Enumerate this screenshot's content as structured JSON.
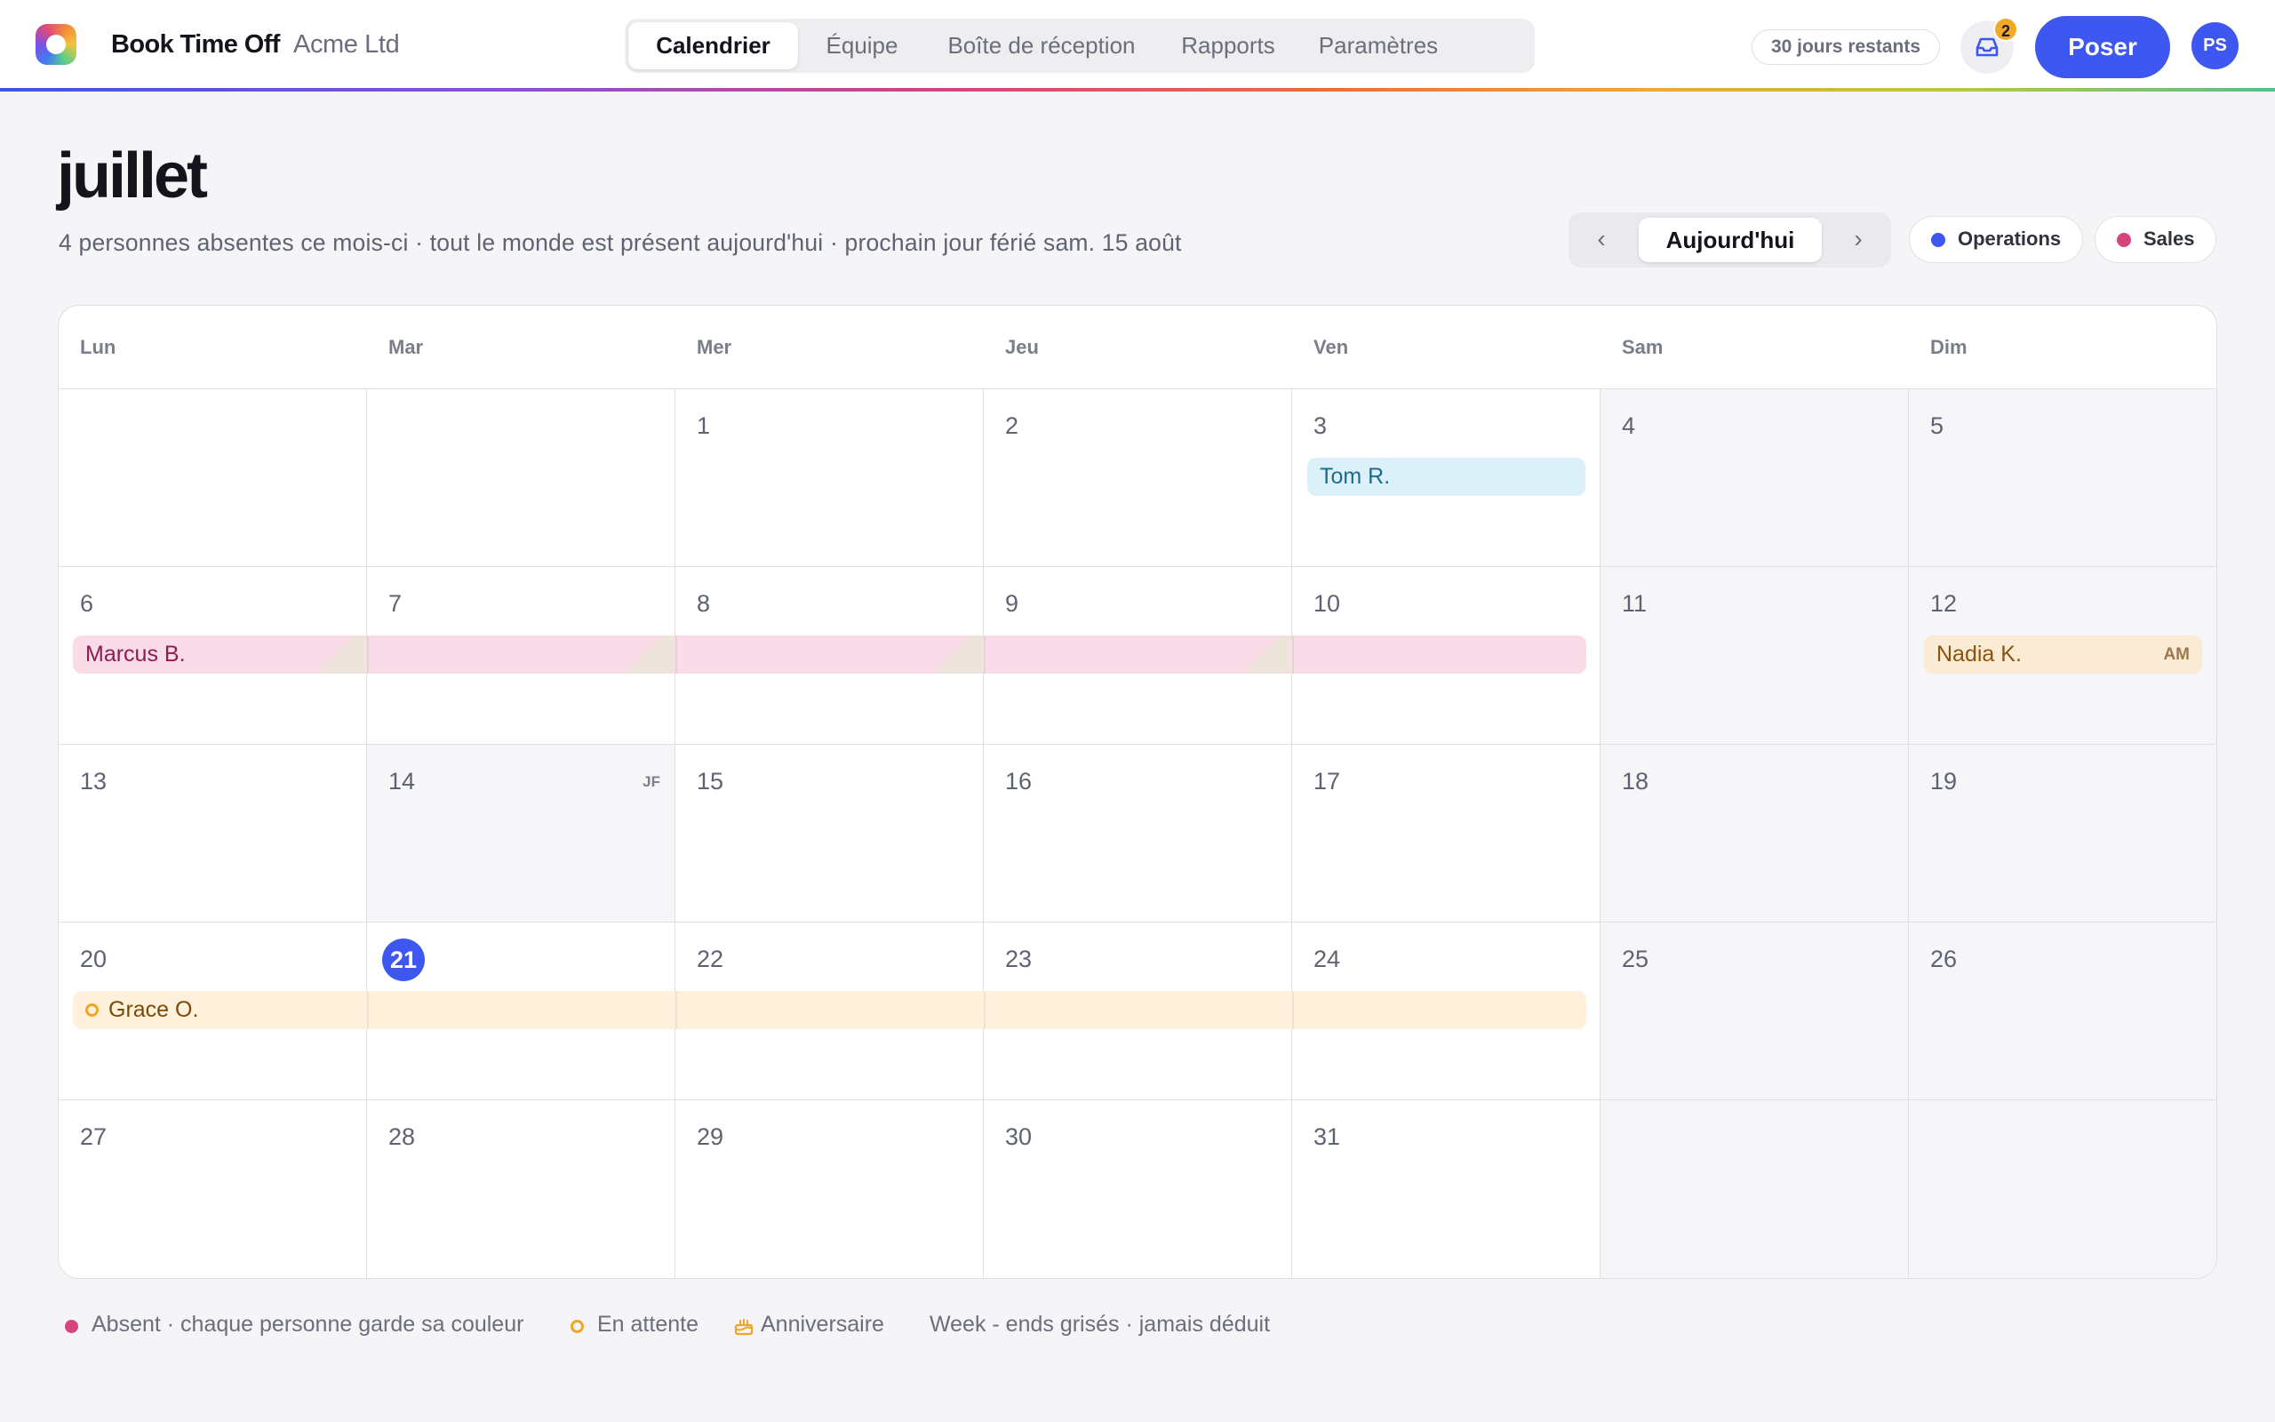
{
  "app": {
    "name": "Book Time Off",
    "org": "Acme Ltd",
    "logo_icon": "app-logo"
  },
  "nav": {
    "tabs": [
      {
        "label": "Calendrier",
        "active": true
      },
      {
        "label": "Équipe",
        "active": false
      },
      {
        "label": "Boîte de réception",
        "active": false
      },
      {
        "label": "Rapports",
        "active": false
      },
      {
        "label": "Paramètres",
        "active": false
      }
    ]
  },
  "header": {
    "days_remaining": "30 jours restants",
    "inbox_badge": "2",
    "inbox_icon": "inbox-icon",
    "primary_action": "Poser",
    "avatar_initials": "PS",
    "accent_color": "#3e57f0"
  },
  "page": {
    "title": "juillet",
    "subtitle": "4 personnes absentes ce mois-ci · tout le monde est présent aujourd'hui · prochain jour férié sam. 15 août"
  },
  "date_nav": {
    "prev_icon": "‹",
    "today_label": "Aujourd'hui",
    "next_icon": "›"
  },
  "team_filters": [
    {
      "label": "Operations",
      "color": "#3e57f0"
    },
    {
      "label": "Sales",
      "color": "#d6447e"
    }
  ],
  "calendar": {
    "weekdays": [
      "Lun",
      "Mar",
      "Mer",
      "Jeu",
      "Ven",
      "Sam",
      "Dim"
    ],
    "weeks": [
      [
        "",
        "",
        "1",
        "2",
        "3",
        "4",
        "5"
      ],
      [
        "6",
        "7",
        "8",
        "9",
        "10",
        "11",
        "12"
      ],
      [
        "13",
        "14",
        "15",
        "16",
        "17",
        "18",
        "19"
      ],
      [
        "20",
        "21",
        "22",
        "23",
        "24",
        "25",
        "26"
      ],
      [
        "27",
        "28",
        "29",
        "30",
        "31",
        "",
        ""
      ]
    ],
    "today": "21",
    "holiday_day": "14",
    "holiday_tag": "JF",
    "events": [
      {
        "name": "Tom R.",
        "status": "absent"
      },
      {
        "name": "Marcus B.",
        "status": "absent"
      },
      {
        "name": "Nadia K.",
        "status": "absent",
        "period": "AM"
      },
      {
        "name": "Grace O.",
        "status": "pending"
      }
    ]
  },
  "legend": {
    "absent": "Absent · chaque personne garde sa couleur",
    "pending": "En attente",
    "birthday": "Anniversaire",
    "weekends": "Week - ends grisés · jamais déduit",
    "absent_color": "#d6447e",
    "pending_color": "#f0a428"
  }
}
